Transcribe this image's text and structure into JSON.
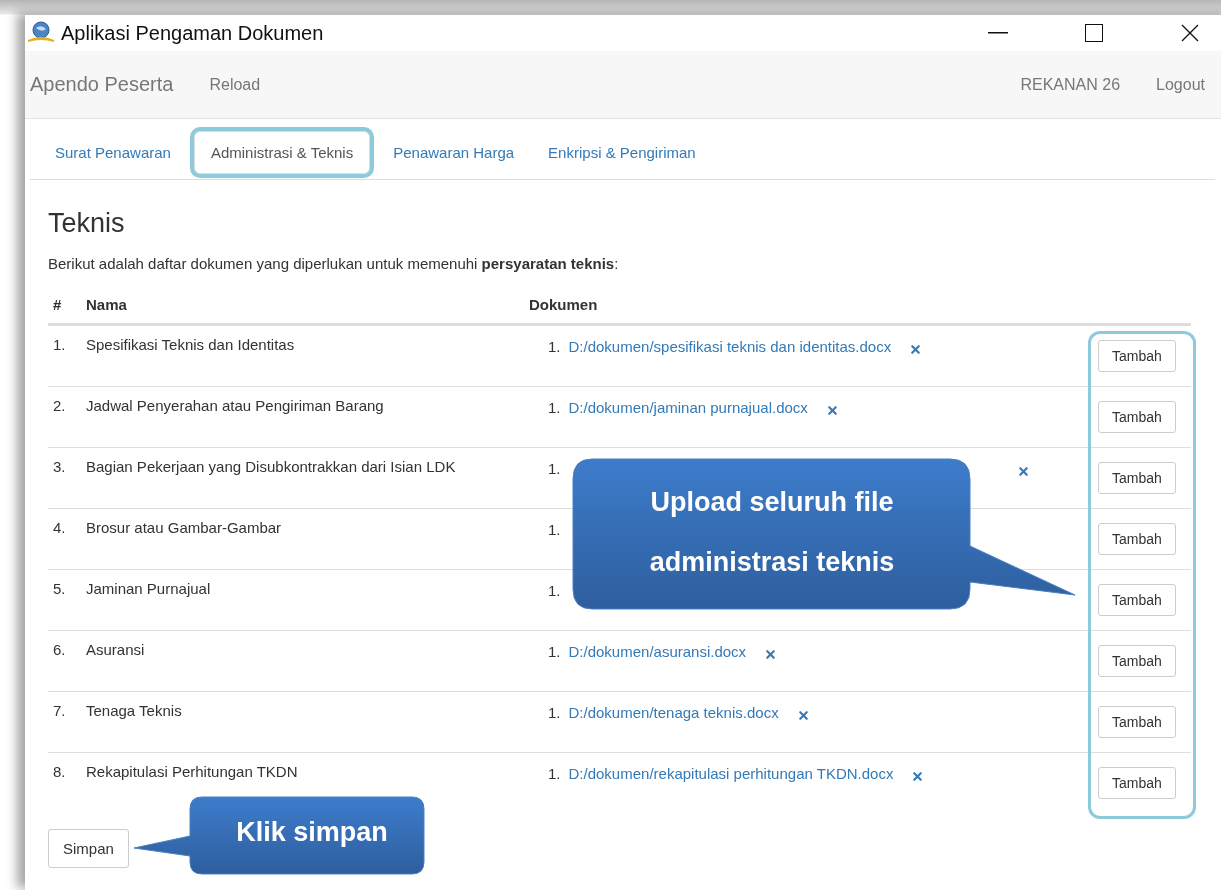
{
  "window": {
    "title": "Aplikasi Pengaman Dokumen"
  },
  "navbar": {
    "brand": "Apendo Peserta",
    "links": [
      "Reload"
    ],
    "user": "REKANAN 26",
    "logout": "Logout"
  },
  "tabs": [
    {
      "label": "Surat Penawaran",
      "selected": false,
      "highlighted": false
    },
    {
      "label": "Administrasi & Teknis",
      "selected": true,
      "highlighted": true
    },
    {
      "label": "Penawaran Harga",
      "selected": false,
      "highlighted": false
    },
    {
      "label": "Enkripsi & Pengiriman",
      "selected": false,
      "highlighted": false
    }
  ],
  "section": {
    "title": "Teknis",
    "description": "Berikut adalah daftar dokumen yang diperlukan untuk memenuhi **persyaratan teknis**:"
  },
  "table": {
    "columns": [
      "#",
      "Nama",
      "Dokumen"
    ],
    "actions_highlighted": true,
    "rows": [
      {
        "number": "1.",
        "name": "Spesifikasi Teknis dan Identitas",
        "documents": [
          {
            "number": "1.",
            "file": "D:/dokumen/spesifikasi teknis dan identitas.docx",
            "removable": true
          }
        ],
        "action": "Tambah"
      },
      {
        "number": "2.",
        "name": "Jadwal Penyerahan atau Pengiriman Barang",
        "documents": [
          {
            "number": "1.",
            "file": "D:/dokumen/jaminan purnajual.docx",
            "removable": true
          }
        ],
        "action": "Tambah"
      },
      {
        "number": "3.",
        "name": "Bagian Pekerjaan yang Disubkontrakkan dari Isian LDK",
        "documents": [
          {
            "number": "1.",
            "removable": true
          }
        ],
        "action": "Tambah"
      },
      {
        "number": "4.",
        "name": "Brosur atau Gambar-Gambar",
        "documents": [
          {
            "number": "1.",
            "removable": false
          }
        ],
        "action": "Tambah"
      },
      {
        "number": "5.",
        "name": "Jaminan Purnajual",
        "documents": [
          {
            "number": "1.",
            "removable": false
          }
        ],
        "action": "Tambah"
      },
      {
        "number": "6.",
        "name": "Asuransi",
        "documents": [
          {
            "number": "1.",
            "file": "D:/dokumen/asuransi.docx",
            "removable": true
          }
        ],
        "action": "Tambah"
      },
      {
        "number": "7.",
        "name": "Tenaga Teknis",
        "documents": [
          {
            "number": "1.",
            "file": "D:/dokumen/tenaga teknis.docx",
            "removable": true
          }
        ],
        "action": "Tambah"
      },
      {
        "number": "8.",
        "name": "Rekapitulasi Perhitungan TKDN",
        "documents": [
          {
            "number": "1.",
            "file": "D:/dokumen/rekapitulasi perhitungan TKDN.docx",
            "removable": true
          }
        ],
        "action": "Tambah"
      }
    ]
  },
  "save_button": "Simpan",
  "callouts": [
    {
      "kind": "actions",
      "text": "Upload seluruh file administrasi teknis"
    },
    {
      "kind": "save",
      "text": "Klik simpan"
    }
  ]
}
